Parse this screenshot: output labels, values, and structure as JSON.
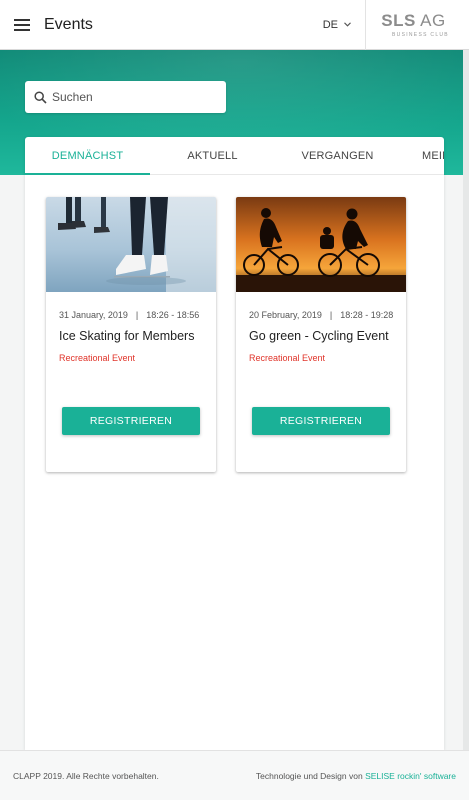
{
  "header": {
    "title": "Events",
    "language": "DE",
    "logo": {
      "main_bold": "SLS",
      "main_light": "AG",
      "sub": "BUSINESS CLUB"
    }
  },
  "search": {
    "placeholder": "Suchen",
    "value": ""
  },
  "tabs": [
    {
      "label": "DEMNÄCHST",
      "active": true
    },
    {
      "label": "AKTUELL",
      "active": false
    },
    {
      "label": "VERGANGEN",
      "active": false
    },
    {
      "label": "MEIN",
      "active": false
    }
  ],
  "events": [
    {
      "date": "31 January, 2019",
      "separator": "|",
      "time": "18:26 - 18:56",
      "title": "Ice Skating for Members",
      "category": "Recreational Event",
      "button": "REGISTRIEREN",
      "image_icon": "ice-skating-photo"
    },
    {
      "date": "20 February, 2019",
      "separator": "|",
      "time": "18:28 - 19:28",
      "title": "Go green - Cycling Event",
      "category": "Recreational Event",
      "button": "REGISTRIEREN",
      "image_icon": "cycling-sunset-photo"
    }
  ],
  "footer": {
    "copyright": "CLAPP 2019. Alle Rechte vorbehalten.",
    "credit_prefix": "Technologie und Design von",
    "credit_link": "SELISE rockin' software"
  },
  "colors": {
    "accent": "#1ab197",
    "category": "#e0342a",
    "hero": "#14a58c"
  }
}
